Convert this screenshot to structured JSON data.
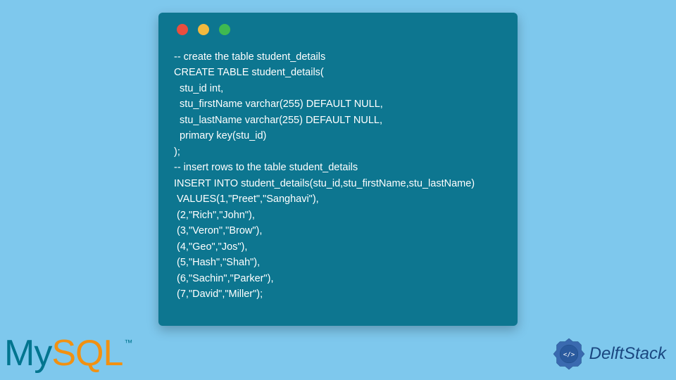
{
  "code": {
    "lines": [
      "-- create the table student_details",
      "CREATE TABLE student_details(",
      "  stu_id int,",
      "  stu_firstName varchar(255) DEFAULT NULL,",
      "  stu_lastName varchar(255) DEFAULT NULL,",
      "  primary key(stu_id)",
      ");",
      "-- insert rows to the table student_details",
      "INSERT INTO student_details(stu_id,stu_firstName,stu_lastName)",
      " VALUES(1,\"Preet\",\"Sanghavi\"),",
      " (2,\"Rich\",\"John\"),",
      " (3,\"Veron\",\"Brow\"),",
      " (4,\"Geo\",\"Jos\"),",
      " (5,\"Hash\",\"Shah\"),",
      " (6,\"Sachin\",\"Parker\"),",
      " (7,\"David\",\"Miller\");"
    ]
  },
  "logos": {
    "mysql_my": "My",
    "mysql_sql": "SQL",
    "mysql_tm": "™",
    "delft": "DelftStack"
  },
  "colors": {
    "background": "#7ec8ed",
    "window": "#0d7690",
    "dot_red": "#e94e3f",
    "dot_yellow": "#f3b93e",
    "dot_green": "#3fb950",
    "mysql_blue": "#00758f",
    "mysql_orange": "#f29111",
    "delft_blue": "#1a4780"
  }
}
